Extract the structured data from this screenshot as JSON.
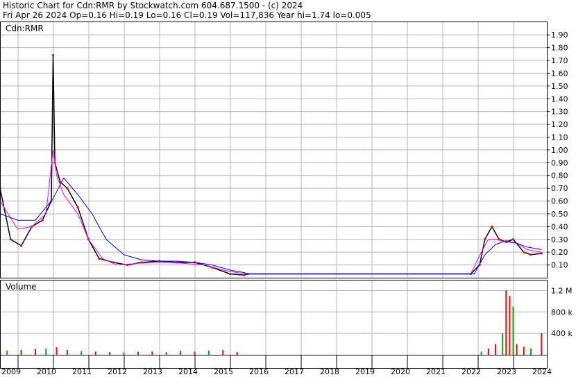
{
  "header": {
    "line1": "Historic Chart for Cdn:RMR by Stockwatch.com 604.687.1500 - (c) 2024",
    "line2": "Fri Apr 26 2024   Op=0.16  Hi=0.19  Lo=0.16  Cl=0.19  Vol=117,836  Year hi=1.74  lo=0.005"
  },
  "colors": {
    "price_bar": "#000000",
    "up_close": "#ff0000",
    "ma_short": "#ff00ff",
    "ma_long": "#0000ff",
    "vol_up": "#00aa00",
    "vol_down": "#ff0000",
    "grid": "#b4b4b4"
  },
  "chart_data": [
    {
      "type": "line",
      "panel": "price",
      "label": "Cdn:RMR",
      "y_ticks": [
        "0.10",
        "0.20",
        "0.30",
        "0.40",
        "0.50",
        "0.60",
        "0.70",
        "0.80",
        "0.90",
        "1.00",
        "1.10",
        "1.20",
        "1.30",
        "1.40",
        "1.50",
        "1.60",
        "1.70",
        "1.80",
        "1.90"
      ],
      "ylim": [
        0,
        1.95
      ],
      "x_ticks": [
        "2009",
        "2010",
        "2011",
        "2012",
        "2013",
        "2014",
        "2015",
        "2016",
        "2017",
        "2018",
        "2019",
        "2020",
        "2021",
        "2022",
        "2023",
        "2024"
      ],
      "xlim": [
        2009.0,
        2024.45
      ],
      "series": [
        {
          "x": [
            2009.0,
            2009.3,
            2009.6,
            2009.9,
            2010.2,
            2010.45,
            2010.5,
            2010.55,
            2010.7,
            2010.9,
            2011.2,
            2011.5,
            2011.8,
            2012.2,
            2012.6,
            2013.0,
            2013.5,
            2014.0,
            2014.5,
            2015.0,
            2015.5,
            2015.9,
            2016.0,
            2022.3,
            2022.55,
            2022.7,
            2022.9,
            2023.1,
            2023.3,
            2023.5,
            2023.8,
            2024.0,
            2024.3
          ],
          "values": [
            0.7,
            0.3,
            0.25,
            0.4,
            0.45,
            0.6,
            1.74,
            0.9,
            0.75,
            0.7,
            0.55,
            0.3,
            0.15,
            0.12,
            0.1,
            0.12,
            0.13,
            0.12,
            0.12,
            0.08,
            0.03,
            0.02,
            0.03,
            0.03,
            0.1,
            0.3,
            0.4,
            0.3,
            0.28,
            0.3,
            0.2,
            0.18,
            0.19
          ]
        },
        {
          "x": [
            2009.0,
            2009.5,
            2009.9,
            2010.3,
            2010.5,
            2010.6,
            2010.8,
            2011.2,
            2011.5,
            2011.9,
            2012.3,
            2012.8,
            2013.3,
            2013.8,
            2014.3,
            2014.8,
            2015.3,
            2015.7,
            2016.0,
            2022.3,
            2022.6,
            2022.8,
            2023.0,
            2023.3,
            2023.6,
            2023.9,
            2024.3
          ],
          "values": [
            0.6,
            0.38,
            0.4,
            0.5,
            1.0,
            0.8,
            0.65,
            0.5,
            0.3,
            0.15,
            0.1,
            0.11,
            0.12,
            0.12,
            0.11,
            0.1,
            0.06,
            0.04,
            0.03,
            0.03,
            0.2,
            0.3,
            0.3,
            0.28,
            0.27,
            0.22,
            0.2
          ]
        },
        {
          "x": [
            2009.0,
            2009.5,
            2010.0,
            2010.5,
            2010.8,
            2011.2,
            2011.6,
            2012.0,
            2012.5,
            2013.0,
            2013.5,
            2014.0,
            2014.5,
            2015.0,
            2015.5,
            2015.9,
            2016.0,
            2022.4,
            2022.7,
            2023.0,
            2023.3,
            2023.6,
            2023.9,
            2024.3
          ],
          "values": [
            0.5,
            0.45,
            0.45,
            0.62,
            0.78,
            0.65,
            0.5,
            0.3,
            0.18,
            0.14,
            0.13,
            0.13,
            0.12,
            0.1,
            0.06,
            0.04,
            0.03,
            0.03,
            0.18,
            0.26,
            0.29,
            0.27,
            0.24,
            0.22
          ]
        }
      ]
    },
    {
      "type": "bar",
      "panel": "volume",
      "label": "Volume",
      "y_ticks": [
        "400 k",
        "800 k",
        "1.2 M"
      ],
      "ylim": [
        0,
        1400000
      ],
      "x": [
        2009.2,
        2009.6,
        2010.0,
        2010.3,
        2010.6,
        2010.9,
        2011.3,
        2011.7,
        2012.1,
        2012.5,
        2012.9,
        2013.3,
        2013.7,
        2014.1,
        2014.5,
        2014.9,
        2015.3,
        2015.7,
        2022.6,
        2022.8,
        2023.0,
        2023.2,
        2023.3,
        2023.4,
        2023.5,
        2023.6,
        2023.8,
        2024.0,
        2024.3
      ],
      "values": [
        80000,
        90000,
        110000,
        120000,
        140000,
        90000,
        70000,
        60000,
        50000,
        45000,
        55000,
        60000,
        50000,
        70000,
        60000,
        80000,
        90000,
        50000,
        60000,
        120000,
        200000,
        400000,
        1200000,
        1100000,
        900000,
        200000,
        150000,
        120000,
        400000
      ]
    }
  ]
}
